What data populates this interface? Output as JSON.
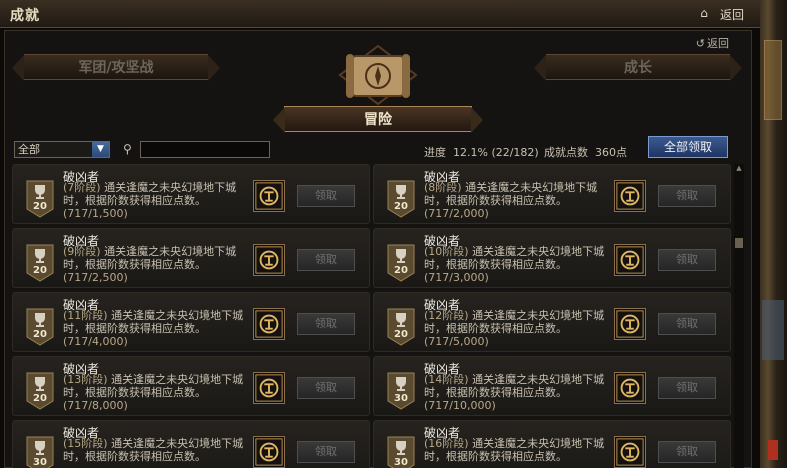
{
  "window": {
    "title": "成就",
    "back_label": "返回"
  },
  "panel": {
    "back_label": "返回"
  },
  "tabs": [
    {
      "label": "军团/攻坚战",
      "active": false
    },
    {
      "label": "冒险",
      "active": true
    },
    {
      "label": "成长",
      "active": false
    }
  ],
  "filter": {
    "selected": "全部",
    "search_value": ""
  },
  "summary": {
    "progress_label": "进度",
    "progress_text": "12.1% (22/182)",
    "points_label": "成就点数",
    "points_value": "360点",
    "claim_all_label": "全部领取"
  },
  "claim_label": "领取",
  "achievements": [
    {
      "name": "破凶者",
      "stage": "(7阶段)",
      "desc": "通关逢魔之未央幻境地下城时，根据阶数获得相应点数。",
      "progress": "(717/1,500)",
      "points": "20"
    },
    {
      "name": "破凶者",
      "stage": "(8阶段)",
      "desc": "通关逢魔之未央幻境地下城时，根据阶数获得相应点数。",
      "progress": "(717/2,000)",
      "points": "20"
    },
    {
      "name": "破凶者",
      "stage": "(9阶段)",
      "desc": "通关逢魔之未央幻境地下城时，根据阶数获得相应点数。",
      "progress": "(717/2,500)",
      "points": "20"
    },
    {
      "name": "破凶者",
      "stage": "(10阶段)",
      "desc": "通关逢魔之未央幻境地下城时，根据阶数获得相应点数。",
      "progress": "(717/3,000)",
      "points": "20"
    },
    {
      "name": "破凶者",
      "stage": "(11阶段)",
      "desc": "通关逢魔之未央幻境地下城时，根据阶数获得相应点数。",
      "progress": "(717/4,000)",
      "points": "20"
    },
    {
      "name": "破凶者",
      "stage": "(12阶段)",
      "desc": "通关逢魔之未央幻境地下城时，根据阶数获得相应点数。",
      "progress": "(717/5,000)",
      "points": "20"
    },
    {
      "name": "破凶者",
      "stage": "(13阶段)",
      "desc": "通关逢魔之未央幻境地下城时，根据阶数获得相应点数。",
      "progress": "(717/8,000)",
      "points": "20"
    },
    {
      "name": "破凶者",
      "stage": "(14阶段)",
      "desc": "通关逢魔之未央幻境地下城时，根据阶数获得相应点数。",
      "progress": "(717/10,000)",
      "points": "30"
    },
    {
      "name": "破凶者",
      "stage": "(15阶段)",
      "desc": "通关逢魔之未央幻境地下城时，根据阶数获得相应点数。",
      "progress": "",
      "points": "30"
    },
    {
      "name": "破凶者",
      "stage": "(16阶段)",
      "desc": "通关逢魔之未央幻境地下城时，根据阶数获得相应点数。",
      "progress": "",
      "points": "30"
    }
  ]
}
